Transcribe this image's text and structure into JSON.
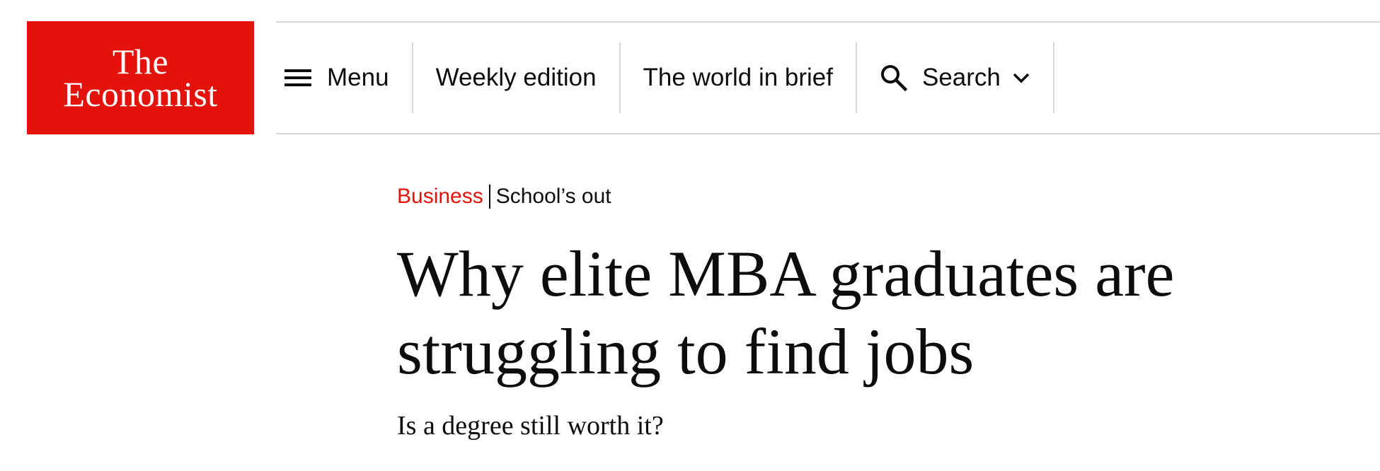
{
  "header": {
    "logo": {
      "line1": "The",
      "line2": "Economist",
      "color": "#e3120b"
    },
    "nav": {
      "menu_label": "Menu",
      "weekly_label": "Weekly edition",
      "brief_label": "The world in brief",
      "search_label": "Search"
    }
  },
  "article": {
    "section": "Business",
    "topic": "School’s out",
    "headline": "Why elite MBA graduates are struggling to find jobs",
    "subheadline": "Is a degree still worth it?"
  },
  "colors": {
    "accent": "#e3120b",
    "text": "#0d0d0d",
    "rule": "#d7d7d7"
  },
  "icons": [
    "hamburger-icon",
    "search-icon",
    "chevron-down-icon"
  ]
}
